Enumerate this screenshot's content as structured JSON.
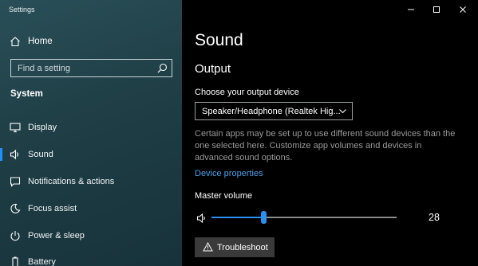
{
  "app": {
    "title": "Settings"
  },
  "window_controls": {
    "minimize": "minimize",
    "maximize": "maximize",
    "close": "close"
  },
  "sidebar": {
    "home_label": "Home",
    "search_placeholder": "Find a setting",
    "section_title": "System",
    "items": [
      {
        "label": "Display",
        "icon": "monitor-icon",
        "selected": false
      },
      {
        "label": "Sound",
        "icon": "speaker-icon",
        "selected": true
      },
      {
        "label": "Notifications & actions",
        "icon": "notification-icon",
        "selected": false
      },
      {
        "label": "Focus assist",
        "icon": "moon-icon",
        "selected": false
      },
      {
        "label": "Power & sleep",
        "icon": "power-icon",
        "selected": false
      },
      {
        "label": "Battery",
        "icon": "battery-icon",
        "selected": false
      }
    ]
  },
  "main": {
    "title": "Sound",
    "section": "Output",
    "device_label": "Choose your output device",
    "device_value": "Speaker/Headphone (Realtek Hig...",
    "info_text": "Certain apps may be set up to use different sound devices than the one selected here. Customize app volumes and devices in advanced sound options.",
    "device_properties_link": "Device properties",
    "volume_label": "Master volume",
    "volume_value": "28",
    "volume_fraction": 0.28,
    "troubleshoot_label": "Troubleshoot"
  },
  "colors": {
    "accent": "#2b8ff0",
    "link": "#4a9fe8",
    "sidebar_bg": "#1f3e46",
    "main_bg": "#000000"
  }
}
